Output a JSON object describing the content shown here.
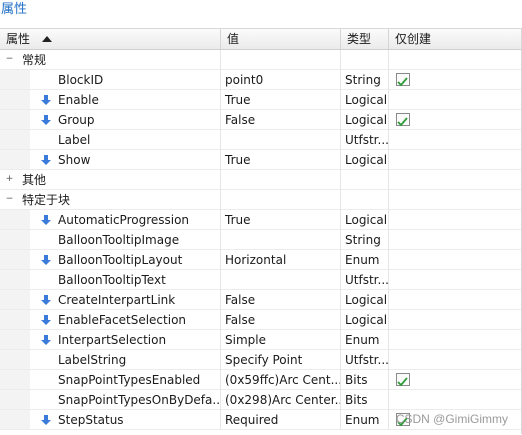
{
  "panel": {
    "title": "属性"
  },
  "columns": {
    "property": "属性",
    "value": "值",
    "type": "类型",
    "create_only": "仅创建"
  },
  "groups": [
    {
      "label": "常规",
      "expanded": true,
      "rows": [
        {
          "name": "BlockID",
          "value": "point0",
          "type": "String",
          "arrow": false,
          "create_only": true
        },
        {
          "name": "Enable",
          "value": "True",
          "type": "Logical",
          "arrow": true,
          "create_only": false
        },
        {
          "name": "Group",
          "value": "False",
          "type": "Logical",
          "arrow": true,
          "create_only": true
        },
        {
          "name": "Label",
          "value": "",
          "type": "Utfstr...",
          "arrow": false,
          "create_only": false
        },
        {
          "name": "Show",
          "value": "True",
          "type": "Logical",
          "arrow": true,
          "create_only": false
        }
      ]
    },
    {
      "label": "其他",
      "expanded": false,
      "rows": []
    },
    {
      "label": "特定于块",
      "expanded": true,
      "rows": [
        {
          "name": "AutomaticProgression",
          "value": "True",
          "type": "Logical",
          "arrow": true,
          "create_only": false
        },
        {
          "name": "BalloonTooltipImage",
          "value": "",
          "type": "String",
          "arrow": false,
          "create_only": false
        },
        {
          "name": "BalloonTooltipLayout",
          "value": "Horizontal",
          "type": "Enum",
          "arrow": true,
          "create_only": false
        },
        {
          "name": "BalloonTooltipText",
          "value": "",
          "type": "Utfstr...",
          "arrow": false,
          "create_only": false
        },
        {
          "name": "CreateInterpartLink",
          "value": "False",
          "type": "Logical",
          "arrow": true,
          "create_only": false
        },
        {
          "name": "EnableFacetSelection",
          "value": "False",
          "type": "Logical",
          "arrow": true,
          "create_only": false
        },
        {
          "name": "InterpartSelection",
          "value": "Simple",
          "type": "Enum",
          "arrow": true,
          "create_only": false
        },
        {
          "name": "LabelString",
          "value": "Specify Point",
          "type": "Utfstr...",
          "arrow": false,
          "create_only": false
        },
        {
          "name": "SnapPointTypesEnabled",
          "value": "(0x59ffc)Arc Cent...",
          "type": "Bits",
          "arrow": false,
          "create_only": true
        },
        {
          "name": "SnapPointTypesOnByDefa...",
          "value": "(0x298)Arc Center...",
          "type": "Bits",
          "arrow": false,
          "create_only": false
        },
        {
          "name": "StepStatus",
          "value": "Required",
          "type": "Enum",
          "arrow": true,
          "create_only": true
        }
      ]
    }
  ],
  "watermark": "CSDN @GimiGimmy",
  "colors": {
    "title": "#1f6fc6",
    "arrow": "#3a7ad8",
    "check": "#2e9b3a"
  }
}
